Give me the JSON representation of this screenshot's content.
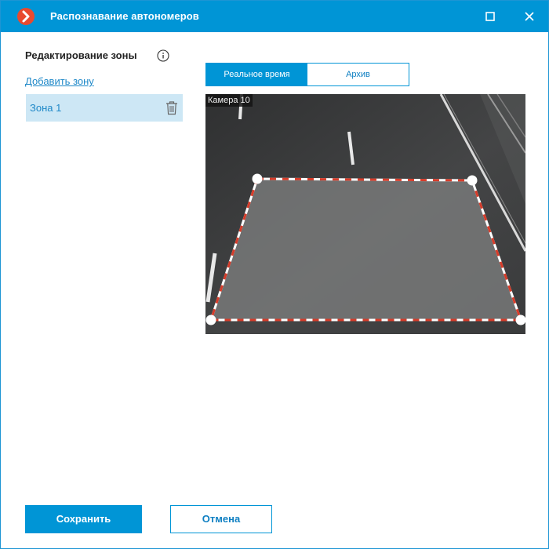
{
  "window": {
    "title": "Распознавание автономеров",
    "accent_color": "#0095d6"
  },
  "sidebar": {
    "section_title": "Редактирование зоны",
    "add_zone_label": "Добавить зону",
    "zones": [
      {
        "label": "Зона 1",
        "selected": true
      }
    ]
  },
  "tabs": [
    {
      "label": "Реальное время",
      "active": true
    },
    {
      "label": "Архив",
      "active": false
    }
  ],
  "video": {
    "camera_label": "Камера 10"
  },
  "footer": {
    "save_label": "Сохранить",
    "cancel_label": "Отмена"
  },
  "icons": {
    "app": "macroscop-logo-icon",
    "maximize": "maximize-icon",
    "close": "close-icon",
    "info": "info-icon",
    "delete": "trash-icon"
  }
}
